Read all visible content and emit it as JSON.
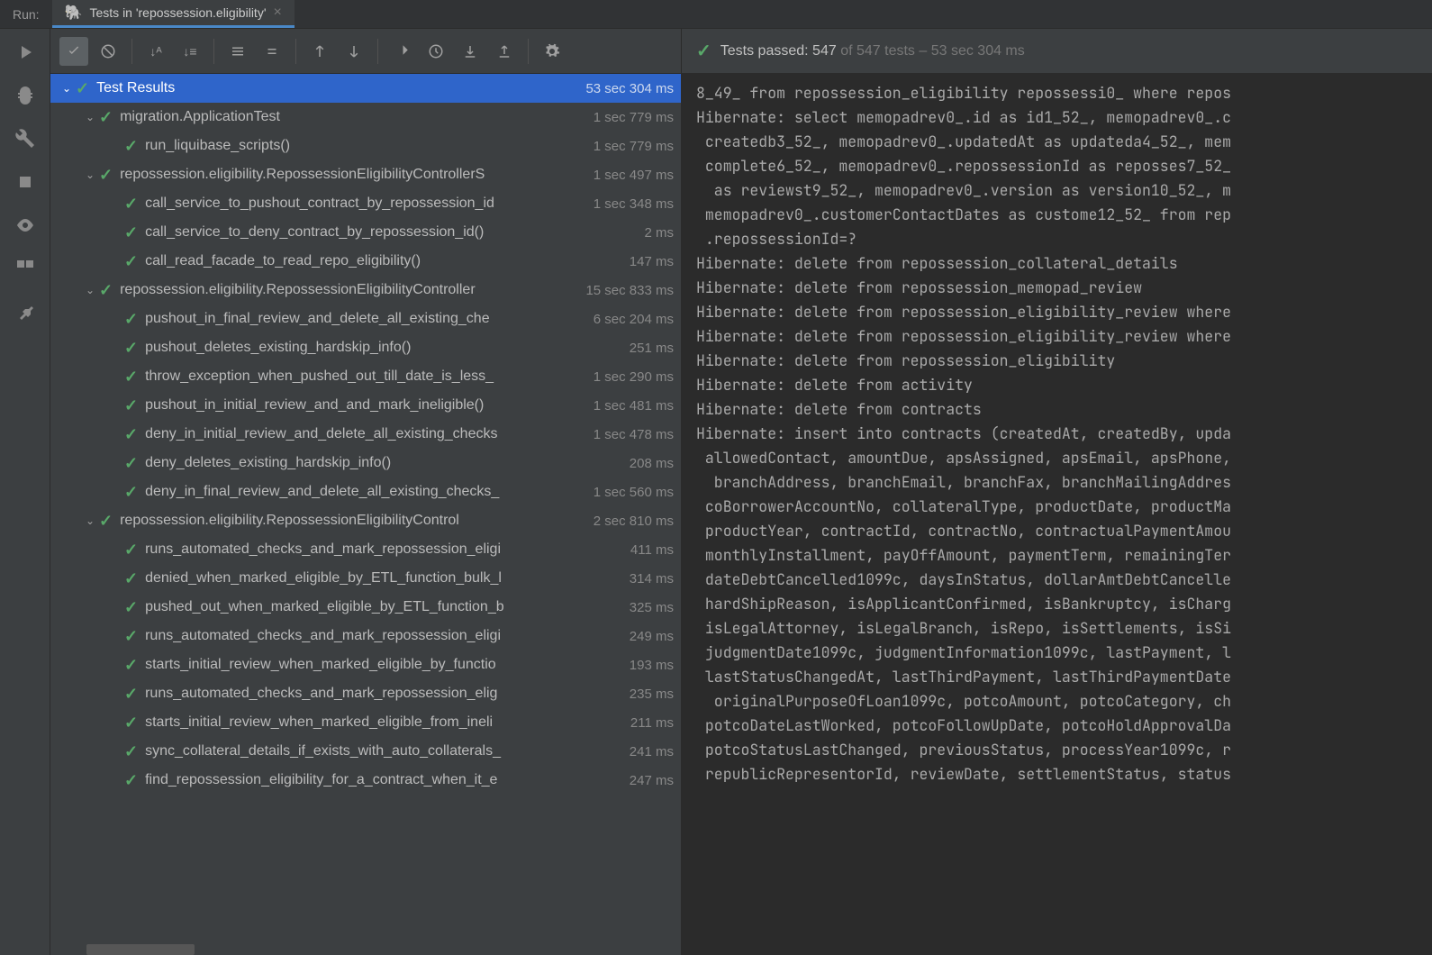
{
  "titlebar": {
    "run_label": "Run:",
    "tab_title": "Tests in 'repossession.eligibility'"
  },
  "status": {
    "prefix": "Tests passed: ",
    "passed": "547",
    "suffix": " of 547 tests – 53 sec 304 ms"
  },
  "tree": {
    "root_label": "Test Results",
    "root_time": "53 sec 304 ms",
    "nodes": [
      {
        "lvl": 1,
        "chev": true,
        "label": "migration.ApplicationTest",
        "time": "1 sec 779 ms"
      },
      {
        "lvl": 2,
        "chev": false,
        "label": "run_liquibase_scripts()",
        "time": "1 sec 779 ms"
      },
      {
        "lvl": 1,
        "chev": true,
        "label": "repossession.eligibility.RepossessionEligibilityControllerS",
        "time": "1 sec 497 ms"
      },
      {
        "lvl": 2,
        "chev": false,
        "label": "call_service_to_pushout_contract_by_repossession_id",
        "time": "1 sec 348 ms"
      },
      {
        "lvl": 2,
        "chev": false,
        "label": "call_service_to_deny_contract_by_repossession_id()",
        "time": "2 ms"
      },
      {
        "lvl": 2,
        "chev": false,
        "label": "call_read_facade_to_read_repo_eligibility()",
        "time": "147 ms"
      },
      {
        "lvl": 1,
        "chev": true,
        "label": "repossession.eligibility.RepossessionEligibilityController",
        "time": "15 sec 833 ms"
      },
      {
        "lvl": 2,
        "chev": false,
        "label": "pushout_in_final_review_and_delete_all_existing_che",
        "time": "6 sec 204 ms"
      },
      {
        "lvl": 2,
        "chev": false,
        "label": "pushout_deletes_existing_hardskip_info()",
        "time": "251 ms"
      },
      {
        "lvl": 2,
        "chev": false,
        "label": "throw_exception_when_pushed_out_till_date_is_less_",
        "time": "1 sec 290 ms"
      },
      {
        "lvl": 2,
        "chev": false,
        "label": "pushout_in_initial_review_and_and_mark_ineligible()",
        "time": "1 sec 481 ms"
      },
      {
        "lvl": 2,
        "chev": false,
        "label": "deny_in_initial_review_and_delete_all_existing_checks",
        "time": "1 sec 478 ms"
      },
      {
        "lvl": 2,
        "chev": false,
        "label": "deny_deletes_existing_hardskip_info()",
        "time": "208 ms"
      },
      {
        "lvl": 2,
        "chev": false,
        "label": "deny_in_final_review_and_delete_all_existing_checks_",
        "time": "1 sec 560 ms"
      },
      {
        "lvl": 1,
        "chev": true,
        "label": "repossession.eligibility.RepossessionEligibilityControl",
        "time": "2 sec 810 ms"
      },
      {
        "lvl": 2,
        "chev": false,
        "label": "runs_automated_checks_and_mark_repossession_eligi",
        "time": "411 ms"
      },
      {
        "lvl": 2,
        "chev": false,
        "label": "denied_when_marked_eligible_by_ETL_function_bulk_l",
        "time": "314 ms"
      },
      {
        "lvl": 2,
        "chev": false,
        "label": "pushed_out_when_marked_eligible_by_ETL_function_b",
        "time": "325 ms"
      },
      {
        "lvl": 2,
        "chev": false,
        "label": "runs_automated_checks_and_mark_repossession_eligi",
        "time": "249 ms"
      },
      {
        "lvl": 2,
        "chev": false,
        "label": "starts_initial_review_when_marked_eligible_by_functio",
        "time": "193 ms"
      },
      {
        "lvl": 2,
        "chev": false,
        "label": "runs_automated_checks_and_mark_repossession_elig",
        "time": "235 ms"
      },
      {
        "lvl": 2,
        "chev": false,
        "label": "starts_initial_review_when_marked_eligible_from_ineli",
        "time": "211 ms"
      },
      {
        "lvl": 2,
        "chev": false,
        "label": "sync_collateral_details_if_exists_with_auto_collaterals_",
        "time": "241 ms"
      },
      {
        "lvl": 2,
        "chev": false,
        "label": "find_repossession_eligibility_for_a_contract_when_it_e",
        "time": "247 ms"
      }
    ]
  },
  "console_lines": [
    "8_49_ from repossession_eligibility repossessi0_ where repos",
    "Hibernate: select memopadrev0_.id as id1_52_, memopadrev0_.c",
    " createdb3_52_, memopadrev0_.updatedAt as updateda4_52_, mem",
    " complete6_52_, memopadrev0_.repossessionId as reposses7_52_",
    "  as reviewst9_52_, memopadrev0_.version as version10_52_, m",
    " memopadrev0_.customerContactDates as custome12_52_ from rep",
    " .repossessionId=?",
    "Hibernate: delete from repossession_collateral_details",
    "Hibernate: delete from repossession_memopad_review",
    "Hibernate: delete from repossession_eligibility_review where",
    "Hibernate: delete from repossession_eligibility_review where",
    "Hibernate: delete from repossession_eligibility",
    "Hibernate: delete from activity",
    "Hibernate: delete from contracts",
    "Hibernate: insert into contracts (createdAt, createdBy, upda",
    " allowedContact, amountDue, apsAssigned, apsEmail, apsPhone,",
    "  branchAddress, branchEmail, branchFax, branchMailingAddres",
    " coBorrowerAccountNo, collateralType, productDate, productMa",
    " productYear, contractId, contractNo, contractualPaymentAmou",
    " monthlyInstallment, payOffAmount, paymentTerm, remainingTer",
    " dateDebtCancelled1099c, daysInStatus, dollarAmtDebtCancelle",
    " hardShipReason, isApplicantConfirmed, isBankruptcy, isCharg",
    " isLegalAttorney, isLegalBranch, isRepo, isSettlements, isSi",
    " judgmentDate1099c, judgmentInformation1099c, lastPayment, l",
    " lastStatusChangedAt, lastThirdPayment, lastThirdPaymentDate",
    "  originalPurposeOfLoan1099c, potcoAmount, potcoCategory, ch",
    " potcoDateLastWorked, potcoFollowUpDate, potcoHoldApprovalDa",
    " potcoStatusLastChanged, previousStatus, processYear1099c, r",
    " republicRepresentorId, reviewDate, settlementStatus, status"
  ]
}
